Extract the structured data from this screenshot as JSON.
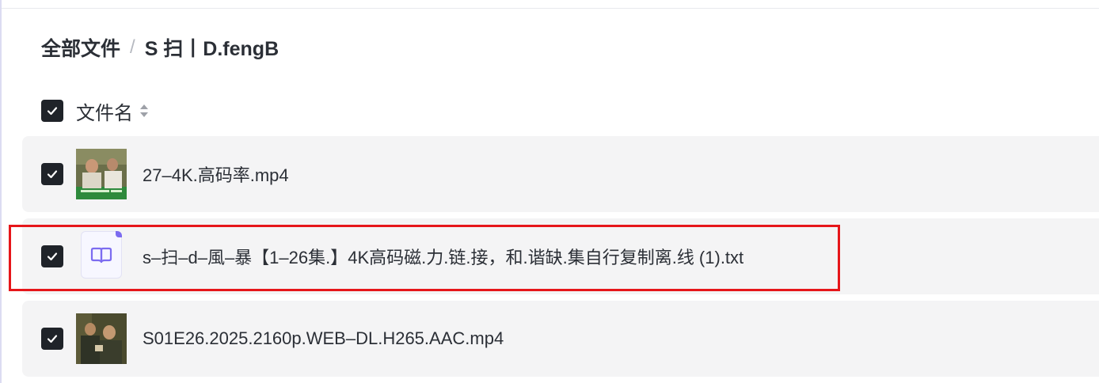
{
  "breadcrumb": {
    "root": "全部文件",
    "separator": "/",
    "current": "S 扫丨D.fengB"
  },
  "list_header": {
    "select_all_checked": true,
    "column_name": "文件名",
    "sort_icon": "sort-updown-icon"
  },
  "files": [
    {
      "name": "27–4K.高码率.mp4",
      "type": "video",
      "checked": true,
      "thumbnail": "video-thumbnail"
    },
    {
      "name": "s–扫–d–風–暴【1–26集.】4K高码磁.力.链.接，和.谐缺.集自行复制离.线 (1).txt",
      "type": "text",
      "checked": true,
      "thumbnail": "book-document-icon",
      "highlighted": true
    },
    {
      "name": "S01E26.2025.2160p.WEB–DL.H265.AAC.mp4",
      "type": "video",
      "checked": true,
      "thumbnail": "video-thumbnail"
    }
  ],
  "colors": {
    "checkbox": "#1f2329",
    "row_background": "#f4f4f5",
    "highlight_border": "#e6161a",
    "doc_icon_accent": "#7c6cf0"
  }
}
